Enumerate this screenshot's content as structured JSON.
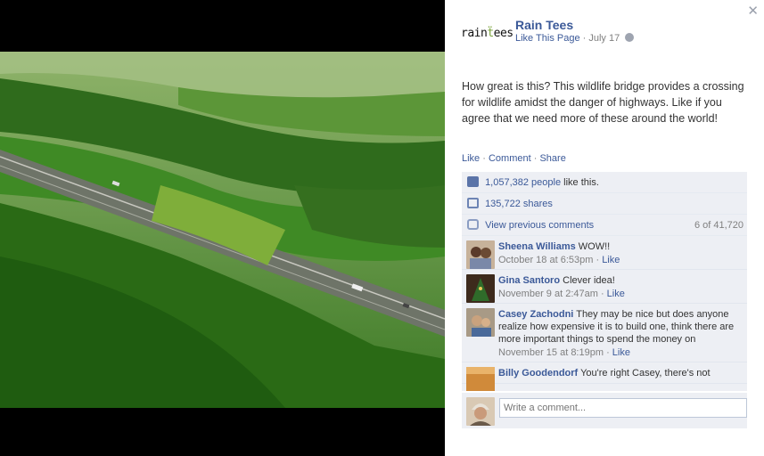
{
  "post": {
    "page_name": "Rain Tees",
    "logo_text": "raintees",
    "like_page": "Like This Page",
    "separator": "·",
    "date": "July 17",
    "text": "How great is this? This wildlife bridge provides a crossing for wildlife amidst the danger of highways. Like if you agree that we need more of these around the world!",
    "action_like": "Like",
    "action_comment": "Comment",
    "action_share": "Share"
  },
  "stats": {
    "likes_count": "1,057,382 people",
    "likes_suffix": " like this.",
    "shares": "135,722 shares",
    "view_previous": "View previous comments",
    "comment_count": "6 of 41,720"
  },
  "comments": [
    {
      "author": "Sheena Williams",
      "text": "WOW!!",
      "time": "October 18 at 6:53pm",
      "like": "Like"
    },
    {
      "author": "Gina Santoro",
      "text": "Clever idea!",
      "time": "November 9 at 2:47am",
      "like": "Like"
    },
    {
      "author": "Casey Zachodni",
      "text": "They may be nice but does anyone realize how expensive it is to build one, think there are more important things to spend the money on",
      "time": "November 15 at 8:19pm",
      "like": "Like"
    },
    {
      "author": "Billy Goodendorf",
      "text": "You're right Casey, there's not"
    }
  ],
  "composer": {
    "placeholder": "Write a comment..."
  },
  "icons": {
    "close": "close-icon",
    "globe": "globe-icon",
    "like": "thumbs-up-icon",
    "share": "share-icon",
    "comment": "comment-bubble-icon"
  },
  "colors": {
    "link": "#3b5998",
    "ufi_bg": "#edeff4",
    "muted": "#7f7f7f"
  }
}
